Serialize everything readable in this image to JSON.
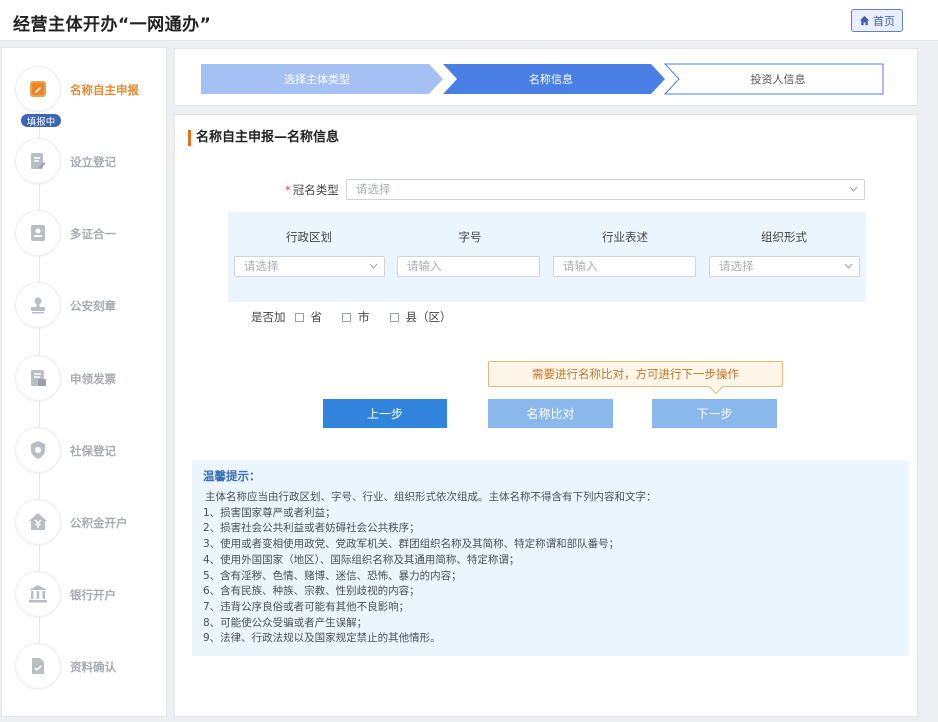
{
  "header": {
    "title": "经营主体开办“一网通办”",
    "home_label": "首页"
  },
  "sidebar": {
    "active_badge": "填报中",
    "items": [
      {
        "label": "名称自主申报",
        "icon": "pen-square-icon"
      },
      {
        "label": "设立登记",
        "icon": "edit-document-icon"
      },
      {
        "label": "多证合一",
        "icon": "id-card-icon"
      },
      {
        "label": "公安刻章",
        "icon": "seal-stamp-icon"
      },
      {
        "label": "申领发票",
        "icon": "invoice-icon"
      },
      {
        "label": "社保登记",
        "icon": "social-shield-icon"
      },
      {
        "label": "公积金开户",
        "icon": "house-fund-icon"
      },
      {
        "label": "银行开户",
        "icon": "bank-icon"
      },
      {
        "label": "资料确认",
        "icon": "file-check-icon"
      }
    ]
  },
  "steps": [
    {
      "label": "选择主体类型",
      "state": "done"
    },
    {
      "label": "名称信息",
      "state": "current"
    },
    {
      "label": "投资人信息",
      "state": "todo"
    }
  ],
  "form": {
    "section_title": "名称自主申报—名称信息",
    "prefix_type_label": "冠名类型",
    "prefix_type_placeholder": "请选择",
    "columns": [
      {
        "header": "行政区划",
        "placeholder": "请选择",
        "kind": "select"
      },
      {
        "header": "字号",
        "placeholder": "请输入",
        "kind": "input"
      },
      {
        "header": "行业表述",
        "placeholder": "请输入",
        "kind": "input"
      },
      {
        "header": "组织形式",
        "placeholder": "请选择",
        "kind": "select"
      }
    ],
    "checkbox_row_label": "是否加",
    "checkboxes": [
      "省",
      "市",
      "县（区）"
    ]
  },
  "tooltip": "需要进行名称比对，方可进行下一步操作",
  "buttons": {
    "prev": "上一步",
    "compare": "名称比对",
    "next": "下一步"
  },
  "notice": {
    "title": "温馨提示：",
    "lines": [
      "主体名称应当由行政区划、字号、行业、组织形式依次组成。主体名称不得含有下列内容和文字：",
      "1、损害国家尊严或者利益；",
      "2、损害社会公共利益或者妨碍社会公共秩序；",
      "3、使用或者变相使用政党、党政军机关、群团组织名称及其简称、特定称谓和部队番号；",
      "4、使用外国国家（地区）、国际组织名称及其通用简称、特定称谓；",
      "5、含有淫秽、色情、赌博、迷信、恐怖、暴力的内容；",
      "6、含有民族、种族、宗教、性别歧视的内容；",
      "7、违背公序良俗或者可能有其他不良影响；",
      "8、可能使公众受骗或者产生误解；",
      "9、法律、行政法规以及国家规定禁止的其他情形。"
    ]
  },
  "colors": {
    "primary": "#2f85dc",
    "step_done": "#a5c1f3",
    "step_current": "#4a7fe5",
    "accent_orange": "#e88a2e"
  }
}
